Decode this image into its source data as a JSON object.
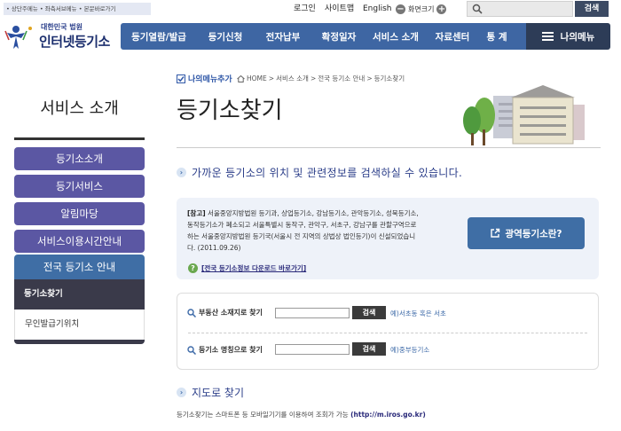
{
  "top": {
    "skip_links": "• 상단주메뉴 • 좌측서브메뉴 • 본문바로가기",
    "login": "로그인",
    "sitemap": "사이트맵",
    "english": "English",
    "fontsize_label": "화면크기",
    "search_button": "검색"
  },
  "logo": {
    "sub": "대한민국 법원",
    "title": "인터넷등기소"
  },
  "gnb": {
    "items": [
      "등기열람/발급",
      "등기신청",
      "전자납부",
      "확정일자",
      "서비스 소개",
      "자료센터",
      "통 계"
    ],
    "mymenu": "나의메뉴"
  },
  "sidebar": {
    "title": "서비스 소개",
    "items": [
      "등기소소개",
      "등기서비스",
      "알림마당",
      "서비스이용시간안내"
    ],
    "active": "전국 등기소 안내",
    "sub_items": [
      "등기소찾기",
      "무인발급기위치"
    ]
  },
  "content": {
    "add_menu": "나의메뉴추가",
    "breadcrumb": [
      "HOME",
      "서비스 소개",
      "전국 등기소 안내",
      "등기소찾기"
    ],
    "page_title": "등기소찾기",
    "lead": "가까운 등기소의 위치 및 관련정보를 검색하실 수 있습니다.",
    "notice": {
      "tag": "[참고]",
      "line1": "서울중앙지방법원 등기과, 상업등기소, 강남등기소, 관악등기소, 성북등기소,",
      "line2": "동작등기소가 폐소되고 서울특별시 동작구, 관악구, 서초구, 강남구를 관할구역으로",
      "line3": "하는 서울중앙지방법원 등기국(서울시 전 지역의 상법상 법인등기)이 신설되었습니",
      "line4": "다. (2011.09.26)"
    },
    "download_link": "[전국 등기소정보 다운로드 바로가기]",
    "wide_button": "광역등기소란?",
    "search_address_label": "부동산 소재지로 찾기",
    "search_address_button": "검색",
    "search_address_example": "예)서초동 혹은 서초",
    "search_name_label": "등기소 명칭으로 찾기",
    "search_name_button": "검색",
    "search_name_example": "예)중부등기소",
    "map_title": "지도로 찾기",
    "mobile_note": "등기소찾기는 스마트폰 등 모바일기기를 이용하여 조회가 가능",
    "mobile_url": "(http://m.iros.go.kr)"
  },
  "colors": {
    "gnb": "#3e66a3",
    "mymenu": "#2d3c57",
    "side_item": "#5b57a3",
    "side_active": "#3f6ea5",
    "side_sub_active": "#3a3a4a"
  }
}
